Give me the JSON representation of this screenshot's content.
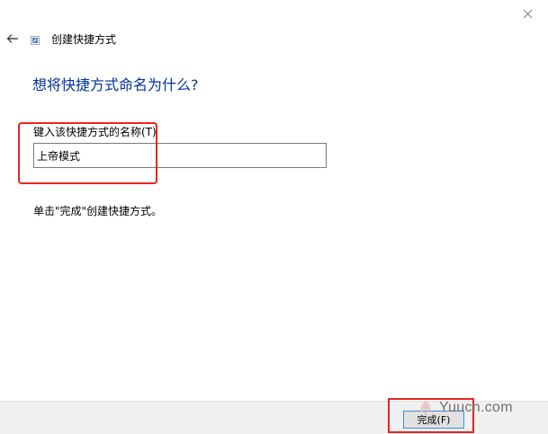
{
  "window": {
    "close_icon": "close-icon"
  },
  "header": {
    "back_icon": "back-arrow-icon",
    "wizard_icon": "shortcut-icon",
    "title": "创建快捷方式"
  },
  "main": {
    "heading": "想将快捷方式命名为什么?",
    "name_label": "键入该快捷方式的名称(T)",
    "name_value": "上帝模式",
    "instruction": "单击\"完成\"创建快捷方式。"
  },
  "footer": {
    "finish_label": "完成(F)"
  },
  "annotations": {
    "highlight_color": "#e8251f"
  },
  "watermark": {
    "text": "Yuucn.com",
    "logo": "yuucn-logo"
  }
}
